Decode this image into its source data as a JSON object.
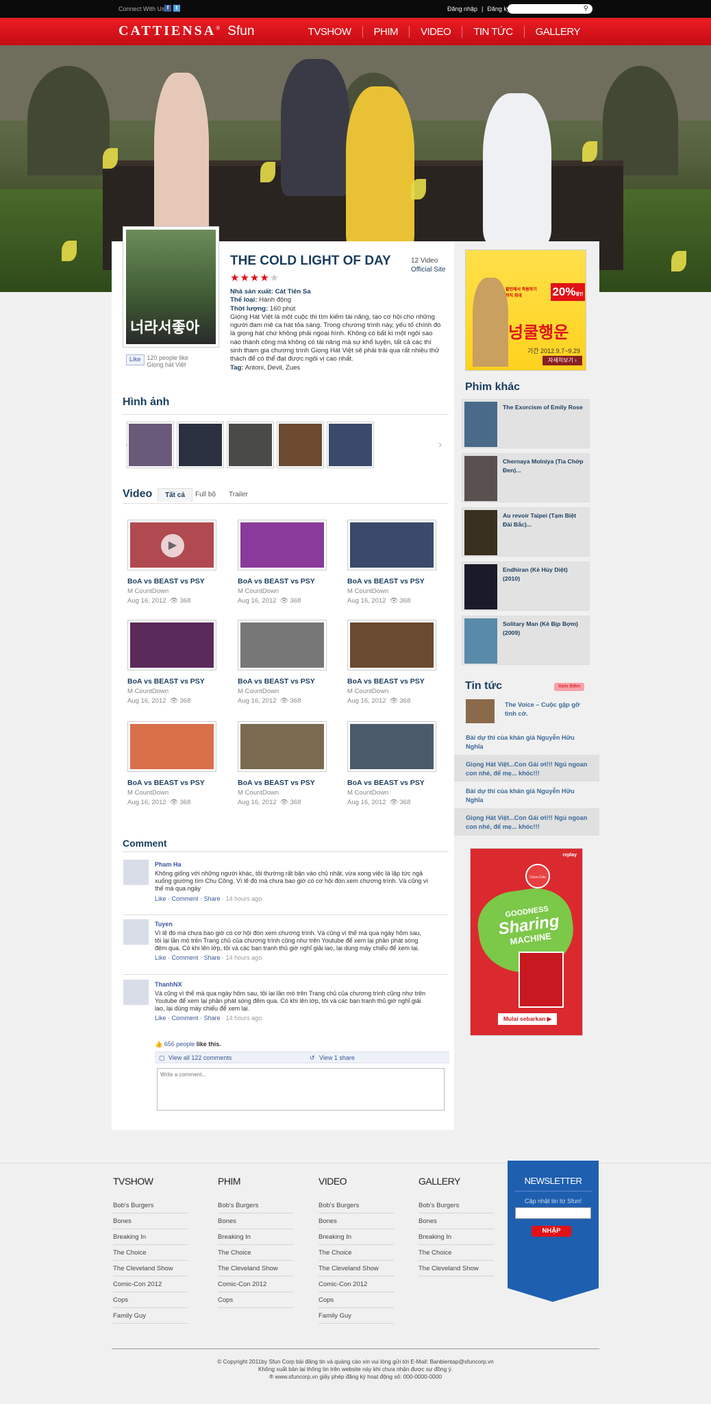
{
  "topbar": {
    "connect": "Connect With Us",
    "facebook_glyph": "f",
    "twitter_glyph": "t",
    "login": "Đăng nhập",
    "separator": "|",
    "register": "Đăng ký"
  },
  "brand": {
    "logo_main": "CATTIENSA",
    "logo_sup": "®",
    "logo_sub": "Sfun",
    "accent": "#e10e16"
  },
  "nav": [
    "TVSHOW",
    "PHIM",
    "VIDEO",
    "TIN TỨC",
    "GALLERY"
  ],
  "movie": {
    "title": "THE COLD LIGHT OF DAY",
    "rating": 4,
    "rating_max": 5,
    "video_count": "12 Video",
    "official_site": "Official Site",
    "poster_text": "너라서좋아",
    "like_button": "Like",
    "like_count": "120 people like",
    "like_target": "Giọng hát Việt",
    "producer_label": "Nhà sản xuất:",
    "producer": "Cát Tiên Sa",
    "genre_label": "Thể loại:",
    "genre": "Hành động",
    "duration_label": "Thời lượng:",
    "duration": "160 phút",
    "description": "Giọng Hát Việt là một cuộc thi tìm kiếm tài năng, tạo cơ hội cho những người đam mê ca hát tỏa sáng. Trong chương trình này, yếu tố chính đó là giọng hát chứ không phải ngoại hình. Không có bất kì một ngôi sao nào thành công mà không có tài năng mà sự khổ luyện, tất cả các thí sinh tham gia chương trình Giọng Hát Việt sẽ phải trải qua rất nhiều thử thách để có thể đạt được ngôi vị cao nhất.",
    "tags_label": "Tag:",
    "tags": "Antoni, Devil, Zues"
  },
  "ad_top": {
    "text1": "할인에서 착용하기까지 최대",
    "percent": "20%",
    "percent_unit": "할인",
    "brand": "넝쿨행운",
    "sub": "기간 2012.9.7~9.29",
    "button": "자세히보기 ›"
  },
  "gallery": {
    "title": "Hình ảnh",
    "prev": "‹",
    "next": "›",
    "thumb_colors": [
      "#6a5a7a",
      "#2a3040",
      "#4a4a48",
      "#6b4a30",
      "#3a4a6a"
    ]
  },
  "video": {
    "title": "Video",
    "tabs": [
      "Tất cả",
      "Full bộ",
      "Trailer"
    ],
    "items": [
      {
        "title": "BoA vs BEAST vs PSY",
        "source": "M CountDown",
        "date": "Aug 16, 2012",
        "views": "368",
        "color": "#b04a50"
      },
      {
        "title": "BoA vs BEAST vs PSY",
        "source": "M CountDown",
        "date": "Aug 16, 2012",
        "views": "368",
        "color": "#8a3a9a"
      },
      {
        "title": "BoA vs BEAST vs PSY",
        "source": "M CountDown",
        "date": "Aug 16, 2012",
        "views": "368",
        "color": "#3a4a6a"
      },
      {
        "title": "BoA vs BEAST vs PSY",
        "source": "M CountDown",
        "date": "Aug 16, 2012",
        "views": "368",
        "color": "#5a2a5a"
      },
      {
        "title": "BoA vs BEAST vs PSY",
        "source": "M CountDown",
        "date": "Aug 16, 2012",
        "views": "368",
        "color": "#777777"
      },
      {
        "title": "BoA vs BEAST vs PSY",
        "source": "M CountDown",
        "date": "Aug 16, 2012",
        "views": "368",
        "color": "#6a4a30"
      },
      {
        "title": "BoA vs BEAST vs PSY",
        "source": "M CountDown",
        "date": "Aug 16, 2012",
        "views": "368",
        "color": "#d8704a"
      },
      {
        "title": "BoA vs BEAST vs PSY",
        "source": "M CountDown",
        "date": "Aug 16, 2012",
        "views": "368",
        "color": "#7a6a50"
      },
      {
        "title": "BoA vs BEAST vs PSY",
        "source": "M CountDown",
        "date": "Aug 16, 2012",
        "views": "368",
        "color": "#4a5a6a"
      }
    ]
  },
  "comments": {
    "title": "Comment",
    "items": [
      {
        "name": "Pham Ha",
        "text": "Không giống với những người khác, tôi thường rất bận vào chủ nhật, vừa xong việc là lập tức ngả xuống giường tìm Chu Công. Vì lẽ đó mà chưa bao giờ có cơ hội đón xem chương trình. Và cũng vì thế mà qua ngày",
        "like": "Like",
        "comment": "Comment",
        "share": "Share",
        "dot": "·",
        "ago": "14 hours ago"
      },
      {
        "name": "Tuyen",
        "text": "Vì lẽ đó mà chưa bao giờ có cơ hội đón xem chương trình. Và cũng vì thế mà qua ngày hôm sau, tôi lại lần mò trên Trang chủ của chương trình cũng như trên Youtube để xem lại phần phát sóng đêm qua. Có khi lên lớp, tôi và các bạn tranh thủ giờ nghỉ giải lao, lại dùng máy chiếu để xem lại.",
        "like": "Like",
        "comment": "Comment",
        "share": "Share",
        "dot": "·",
        "ago": "14 hours ago"
      },
      {
        "name": "ThanhNX",
        "text": "Và cũng vì thế mà qua ngày hôm sau, tôi lại lần mò trên Trang chủ của chương trình cũng như trên Youtube để xem lại phần phát sóng đêm qua. Có khi lên lớp, tôi và các bạn tranh thủ giờ nghỉ giải lao, lại dùng máy chiếu để xem lại.",
        "like": "Like",
        "comment": "Comment",
        "share": "Share",
        "dot": "·",
        "ago": "14 hours ago"
      }
    ],
    "likes": "656 people",
    "likes_suffix": "like this.",
    "view_all": "View all 122 comments",
    "view_share": "View 1 share",
    "placeholder": "Write a comment..."
  },
  "phim_khac": {
    "title": "Phim khác",
    "items": [
      {
        "title": "The Exorcism of Emily Rose",
        "color": "#4a6a8a"
      },
      {
        "title": "Chernaya Molniya (Tia Chớp Đen)...",
        "color": "#5a5050"
      },
      {
        "title": "Au revoir Taipei (Tạm Biệt Đài Bắc)...",
        "color": "#3a3020"
      },
      {
        "title": "Endhiran (Kẻ Hủy Diệt) (2010)",
        "color": "#1a1a2a"
      },
      {
        "title": "Solitary Man (Kẻ Bịp Bợm) (2009)",
        "color": "#5a8aaa"
      }
    ]
  },
  "tin_tuc": {
    "title": "Tin tức",
    "more": "Xem thêm",
    "items": [
      "The Voice – Cuộc gặp gỡ tình cờ.",
      "Bài dự thi của khán giả Nguyễn Hữu Nghĩa",
      "Giọng Hát Việt...Con Gái ơi!!! Ngủ ngoan con nhé, để mẹ... khóc!!!",
      "Bài dự thi của khán giả Nguyễn Hữu Nghĩa",
      "Giọng Hát Việt...Con Gái ơi!!! Ngủ ngoan con nhé, để mẹ... khóc!!!"
    ]
  },
  "ad_coke": {
    "tag": "replay",
    "brand": "Coca-Cola",
    "headline1": "GOODNESS",
    "headline2": "Sharing",
    "headline3": "MACHINE",
    "button": "Mulai sebarkan ▶"
  },
  "footer": {
    "columns": [
      {
        "title": "TVSHOW",
        "items": [
          "Bob's Burgers",
          "Bones",
          "Breaking In",
          "The Choice",
          "The Cleveland Show",
          "Comic-Con 2012",
          "Cops",
          "Family Guy"
        ]
      },
      {
        "title": "PHIM",
        "items": [
          "Bob's Burgers",
          "Bones",
          "Breaking In",
          "The Choice",
          "The Cleveland Show",
          "Comic-Con 2012",
          "Cops"
        ]
      },
      {
        "title": "VIDEO",
        "items": [
          "Bob's Burgers",
          "Bones",
          "Breaking In",
          "The Choice",
          "The Cleveland Show",
          "Comic-Con 2012",
          "Cops",
          "Family Guy"
        ]
      },
      {
        "title": "GALLERY",
        "items": [
          "Bob's Burgers",
          "Bones",
          "Breaking In",
          "The Choice",
          "The Cleveland Show"
        ]
      }
    ],
    "newsletter": {
      "title": "NEWSLETTER",
      "subtitle": "Cập nhật tin từ Sfun!",
      "button": "NHẬP"
    },
    "copyright": [
      "© Copyright 2011by Sfun Corp bài đăng tin và quảng cáo xin vui lòng gửi tới E-Mail: Banbientap@sfuncorp.vn",
      "Không xuất bản lại thông tin trên website này khi chưa nhận được sự đồng ý.",
      "® www.sfuncorp.vn giấy phép đăng ký hoạt động số: 000-0000-0000"
    ]
  }
}
